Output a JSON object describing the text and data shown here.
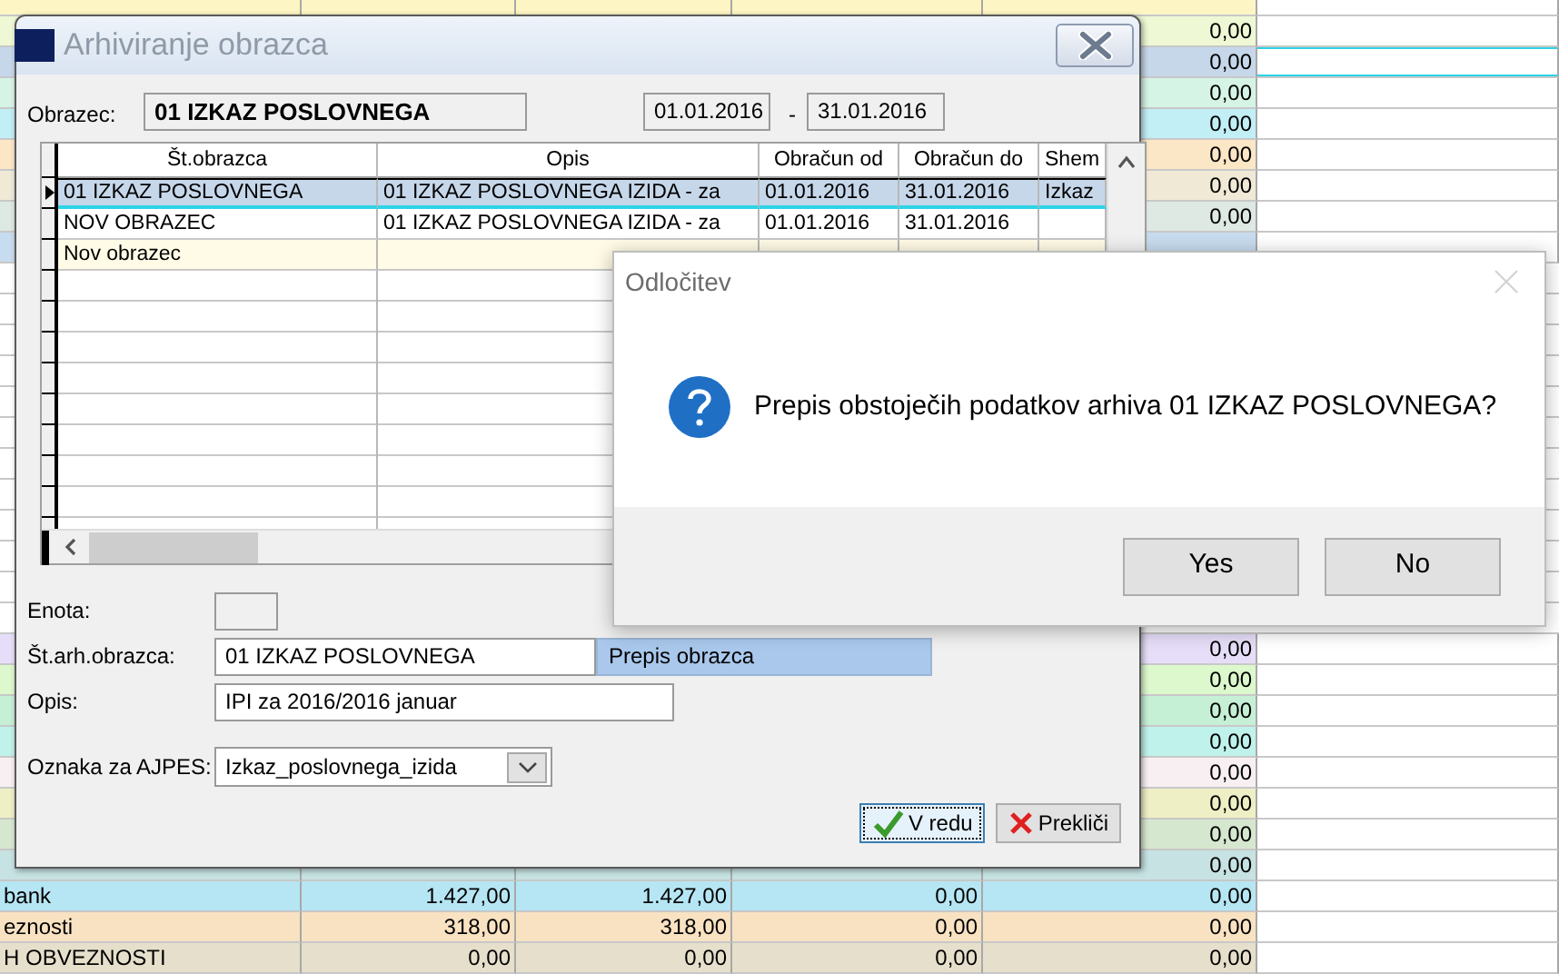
{
  "spreadsheet": {
    "top_rows": [
      {
        "selected": false,
        "color": "#fdf6c4"
      },
      {
        "selected": false,
        "color": "#eef8d4",
        "column_5": "0,00"
      },
      {
        "selected": true,
        "color": "#c6d7ea",
        "column_5": "0,00"
      },
      {
        "selected": false,
        "color": "#d6f4e6",
        "column_5": "0,00"
      },
      {
        "selected": false,
        "color": "#c2eef6",
        "column_5": "0,00"
      },
      {
        "selected": false,
        "color": "#fbe6c6",
        "column_5": "0,00"
      },
      {
        "selected": false,
        "color": "#efe9d6",
        "column_5": "0,00"
      },
      {
        "selected": false,
        "color": "#dde9e2",
        "column_5": "0,00"
      },
      {
        "selected": false,
        "color": "#c8dcef"
      }
    ],
    "bottom_rows": [
      {
        "selected": false,
        "color": "#e6def8",
        "column_5": "0,00"
      },
      {
        "selected": false,
        "color": "#dcf8cc",
        "column_5": "0,00"
      },
      {
        "selected": false,
        "color": "#c6f0d6",
        "column_5": "0,00"
      },
      {
        "selected": false,
        "color": "#bff2ea",
        "column_5": "0,00"
      },
      {
        "selected": false,
        "color": "#f8eff3",
        "column_5": "0,00"
      },
      {
        "selected": false,
        "color": "#efefc6",
        "column_5": "0,00"
      },
      {
        "selected": false,
        "color": "#d6e7cf",
        "column_5": "0,00"
      },
      {
        "selected": false,
        "color": "#c6e2e2",
        "column_5": "0,00"
      },
      {
        "selected": false,
        "color": "#b6e6f3",
        "label": "bank",
        "column_2": "1.427,00",
        "column_3": "1.427,00",
        "column_4": "0,00",
        "column_5": "0,00"
      },
      {
        "selected": false,
        "color": "#f8e2c2",
        "label": "eznosti",
        "column_2": "318,00",
        "column_3": "318,00",
        "column_4": "0,00",
        "column_5": "0,00"
      },
      {
        "selected": false,
        "color": "#e6dfcb",
        "label": "H OBVEZNOSTI",
        "column_2": "0,00",
        "column_3": "0,00",
        "column_4": "0,00",
        "column_5": "0,00"
      }
    ]
  },
  "archive_dialog": {
    "title": "Arhiviranje obrazca",
    "form_label": "Obrazec:",
    "form_value": "01 IZKAZ POSLOVNEGA",
    "date_from": "01.01.2016",
    "date_separator": "-",
    "date_to": "31.01.2016",
    "grid": {
      "columns": [
        "Št.obrazca",
        "Opis",
        "Obračun od",
        "Obračun do",
        "Shem"
      ],
      "rows": [
        {
          "selected": true,
          "kind": "record",
          "cells": [
            "01 IZKAZ POSLOVNEGA",
            "01 IZKAZ POSLOVNEGA IZIDA - za",
            "01.01.2016",
            "31.01.2016",
            "Izkaz"
          ]
        },
        {
          "selected": false,
          "kind": "record",
          "cells": [
            "NOV OBRAZEC",
            "01 IZKAZ POSLOVNEGA IZIDA - za",
            "01.01.2016",
            "31.01.2016"
          ]
        },
        {
          "selected": false,
          "kind": "new",
          "cells": [
            "Nov obrazec"
          ]
        }
      ]
    },
    "fields": [
      {
        "kind": "text",
        "label": "Enota:"
      },
      {
        "kind": "text",
        "label": "Št.arh.obrazca:",
        "value": "01 IZKAZ POSLOVNEGA",
        "note": "Prepis obrazca"
      },
      {
        "kind": "text",
        "label": "Opis:",
        "value": "IPI za 2016/2016 januar"
      },
      {
        "kind": "dropdown",
        "label": "Oznaka za AJPES:",
        "value": "Izkaz_poslovnega_izida"
      }
    ],
    "buttons": [
      {
        "kind": "ok",
        "label": "V redu",
        "focused": true
      },
      {
        "kind": "cancel",
        "label": "Prekliči",
        "focused": false
      }
    ]
  },
  "confirm_dialog": {
    "title": "Odločitev",
    "message": "Prepis obstoječih podatkov arhiva 01 IZKAZ POSLOVNEGA?",
    "buttons": [
      "Yes",
      "No"
    ]
  }
}
